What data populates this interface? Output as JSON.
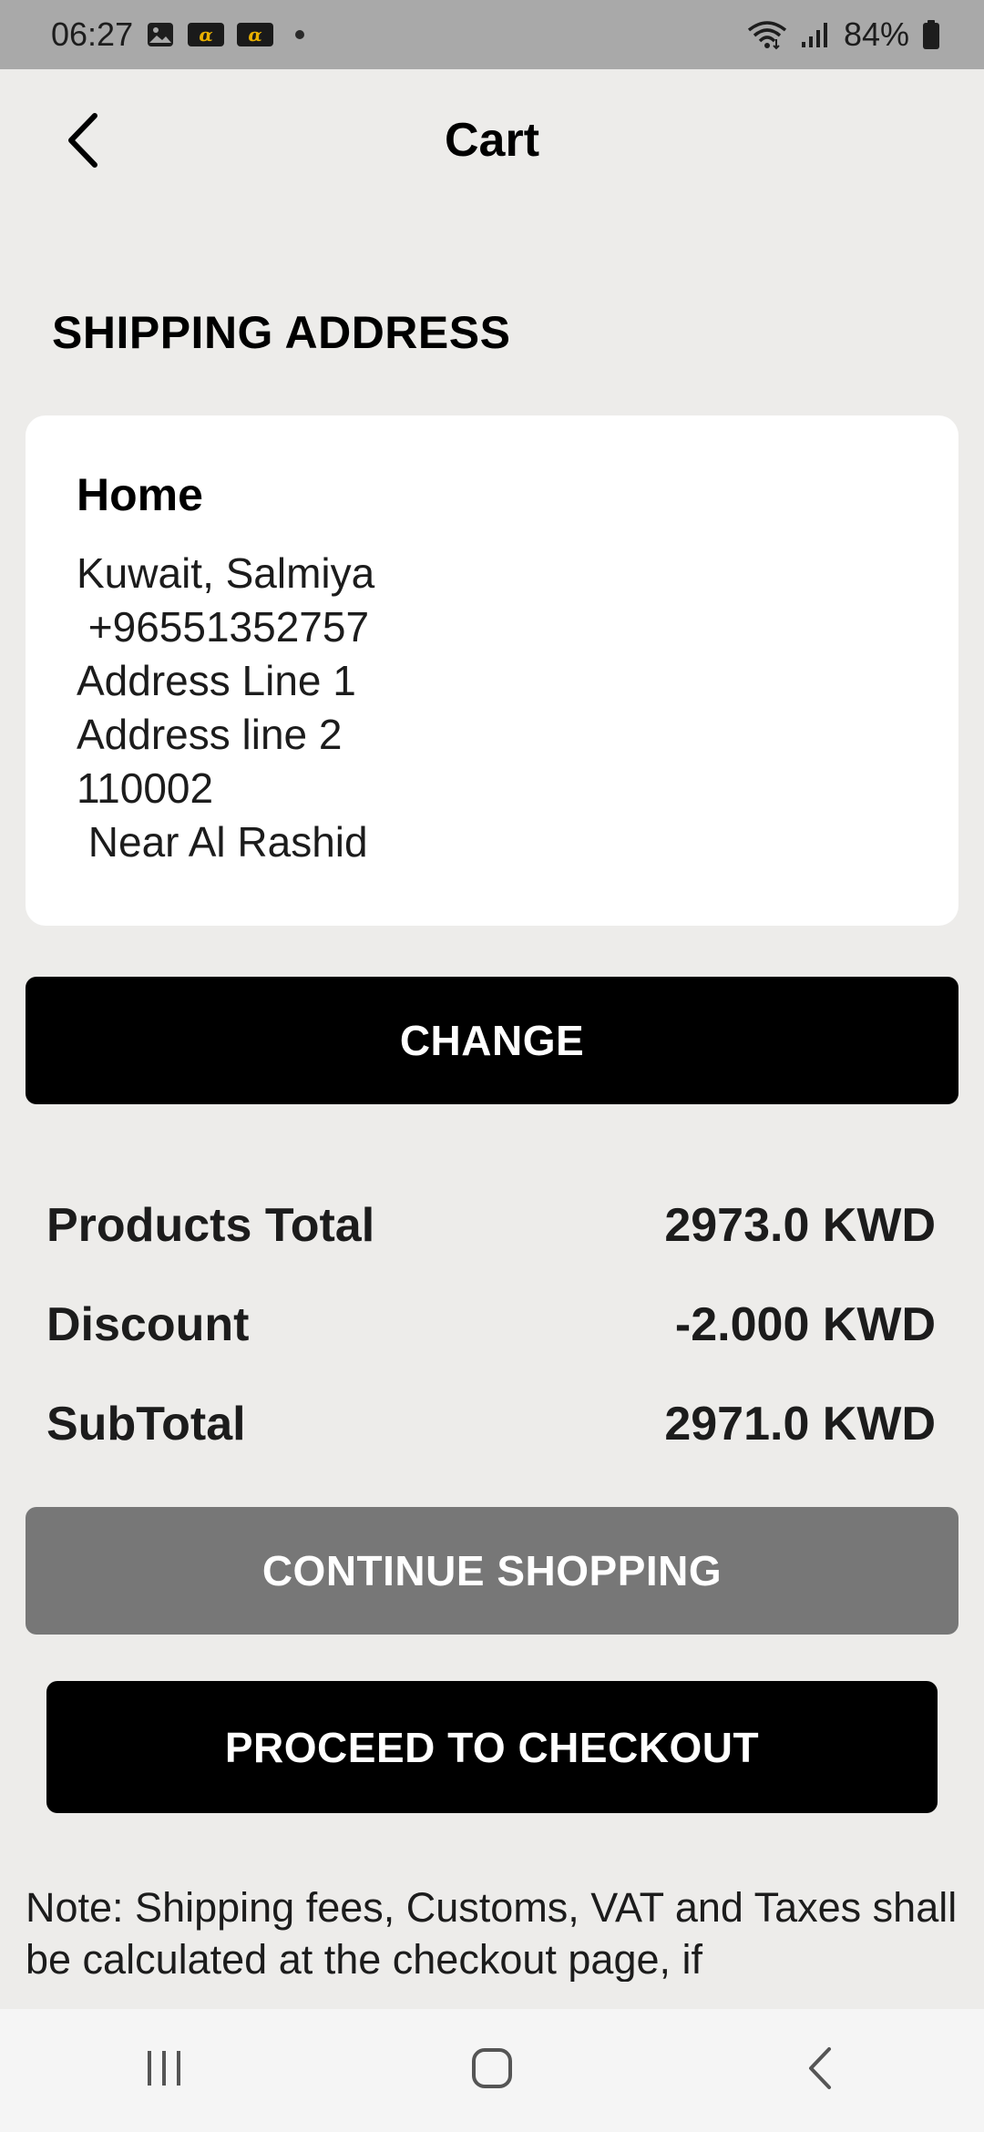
{
  "status_bar": {
    "time": "06:27",
    "battery": "84%",
    "icons": [
      "gallery-icon",
      "app-badge-icon",
      "app-badge-icon",
      "notification-dot-icon",
      "wifi-icon",
      "signal-icon",
      "battery-icon"
    ]
  },
  "header": {
    "title": "Cart",
    "back_icon": "chevron-left-icon"
  },
  "shipping": {
    "section_title": "SHIPPING ADDRESS",
    "address": {
      "name": "Home",
      "lines": [
        "Kuwait, Salmiya",
        " +96551352757",
        "Address Line 1",
        "Address line 2",
        "110002",
        " Near Al Rashid"
      ]
    },
    "change_label": "CHANGE"
  },
  "summary": {
    "rows": [
      {
        "label": "Products Total",
        "value": "2973.0 KWD"
      },
      {
        "label": "Discount",
        "value": "-2.000 KWD"
      },
      {
        "label": "SubTotal",
        "value": "2971.0 KWD"
      }
    ]
  },
  "actions": {
    "continue_label": "CONTINUE SHOPPING",
    "checkout_label": "PROCEED TO CHECKOUT"
  },
  "note": "Note: Shipping fees, Customs, VAT and Taxes shall be calculated at the checkout page, if",
  "nav_bar": {
    "icons": [
      "recent-apps-icon",
      "home-icon",
      "back-icon"
    ]
  },
  "colors": {
    "background": "#edecea",
    "primary_button": "#000000",
    "secondary_button": "#777777",
    "card": "#ffffff"
  }
}
